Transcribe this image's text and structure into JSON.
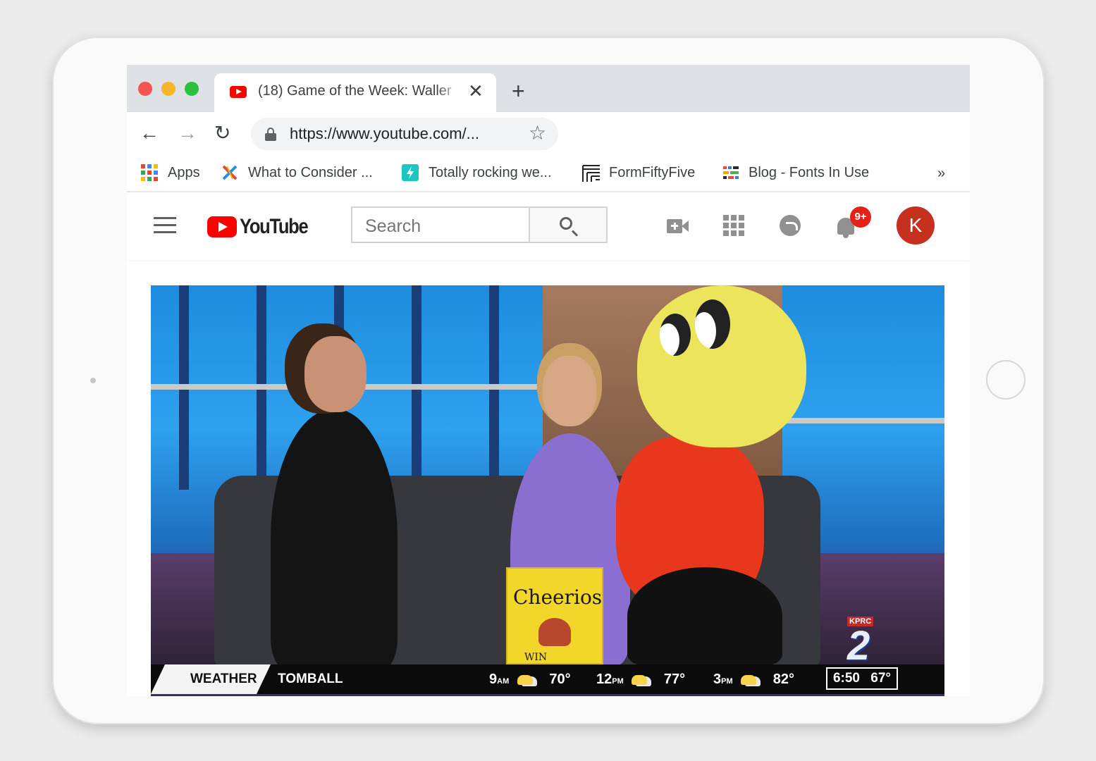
{
  "browser": {
    "tab_title": "(18) Game of the Week: Waller",
    "tab_close": "✕",
    "new_tab": "+",
    "url": "https://www.youtube.com/...",
    "nav": {
      "back": "←",
      "forward": "→",
      "reload": "↻",
      "star": "☆"
    },
    "bookmarks": [
      {
        "label": "Apps",
        "icon": "apps-grid-icon"
      },
      {
        "label": "What to Consider ...",
        "icon": "x-logo-icon"
      },
      {
        "label": "Totally rocking we...",
        "icon": "bolt-icon"
      },
      {
        "label": "FormFiftyFive",
        "icon": "formfiftyfive-icon"
      },
      {
        "label": "Blog - Fonts In Use",
        "icon": "fonts-in-use-icon"
      }
    ],
    "more": "»"
  },
  "youtube": {
    "logo_text": "YouTube",
    "search_placeholder": "Search",
    "notification_count": "9+",
    "avatar_initial": "K"
  },
  "video": {
    "ticker": {
      "label": "WEATHER",
      "location": "TOMBALL",
      "forecast": [
        {
          "time": "9",
          "suffix": "AM",
          "temp": "70°"
        },
        {
          "time": "12",
          "suffix": "PM",
          "temp": "77°"
        },
        {
          "time": "3",
          "suffix": "PM",
          "temp": "82°"
        }
      ],
      "clock": "6:50",
      "current_temp": "67°"
    },
    "station": {
      "name": "KPRC",
      "number": "2"
    },
    "box_text": "Cheerios",
    "box_sub": "WIN"
  },
  "colors": {
    "youtube_red": "#ff0000",
    "avatar": "#c6311f",
    "badge": "#e62117",
    "tabbar": "#dee1e6"
  }
}
